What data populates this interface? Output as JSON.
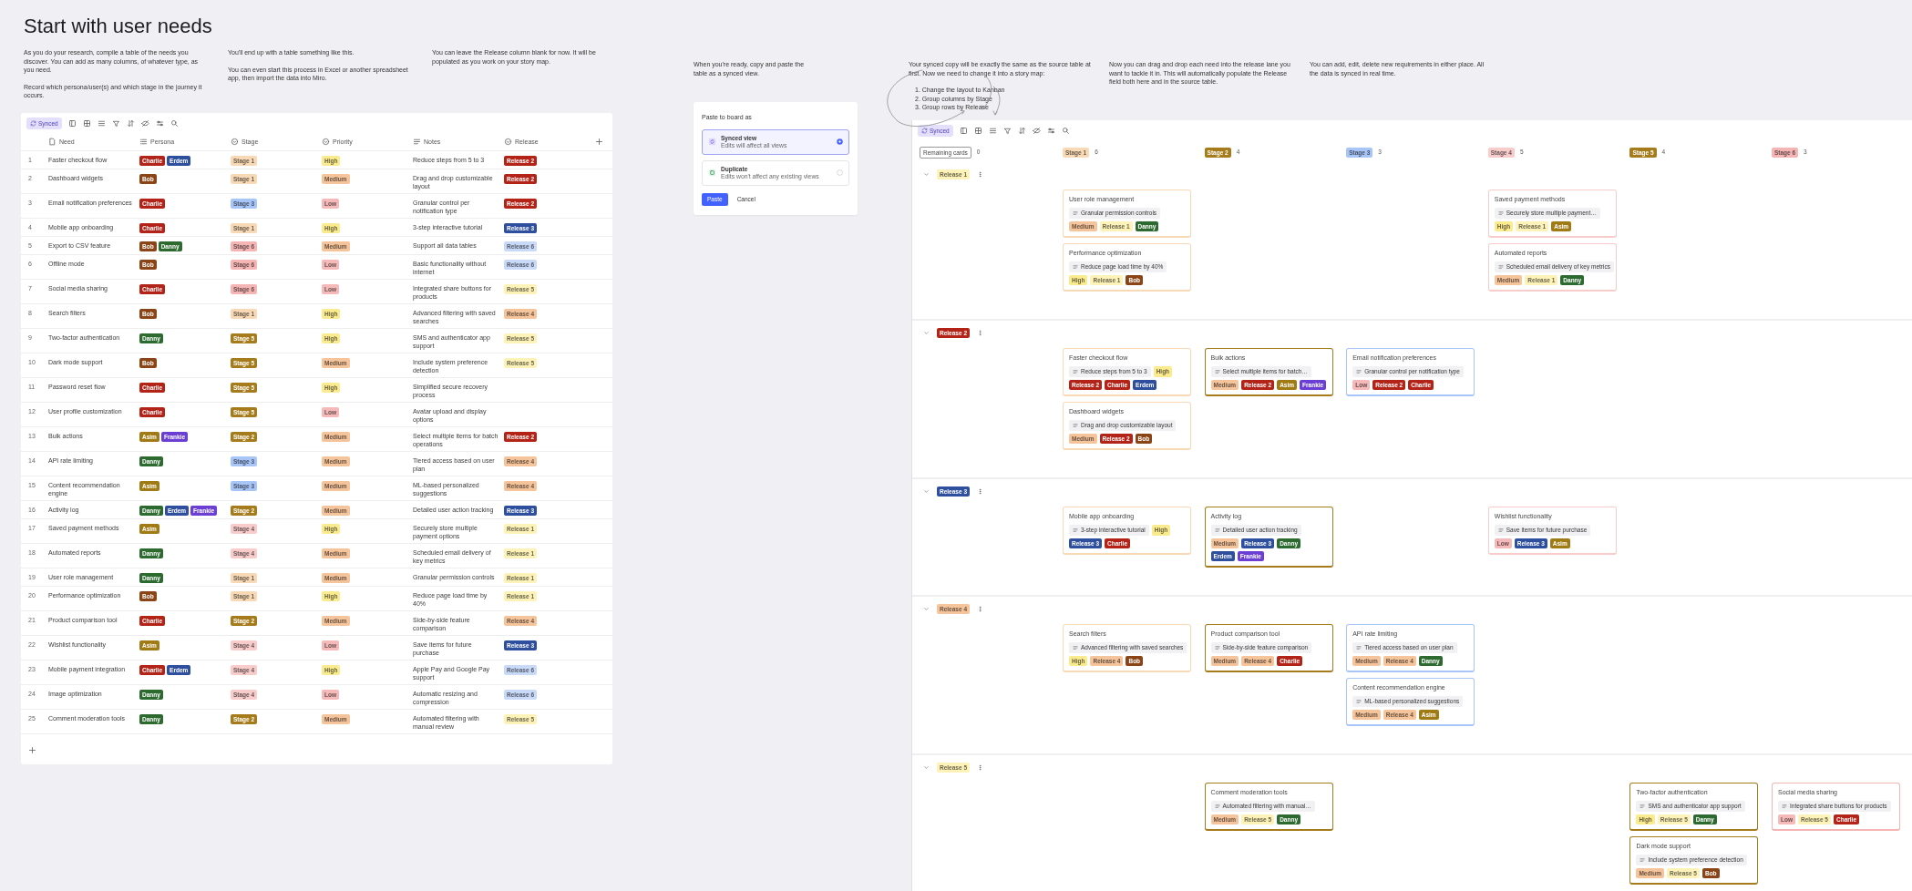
{
  "page": {
    "title": "Start with user needs"
  },
  "left_notes": [
    {
      "paragraphs": [
        "As you do your research, compile a table of the needs you discover. You can add as many columns, of whatever type, as you need.",
        "Record which persona/user(s) and which stage in the journey it occurs."
      ]
    },
    {
      "paragraphs": [
        "You'll end up with a table something like this.",
        "You can even start this process in Excel or another spreadsheet app, then import the data into Miro."
      ]
    },
    {
      "paragraphs": [
        "You can leave the Release column blank for now. It will be populated as you work on your story map."
      ]
    }
  ],
  "table": {
    "toolbar": {
      "label": "Synced"
    },
    "columns": [
      {
        "label": "Need",
        "kind": "title"
      },
      {
        "label": "Persona",
        "kind": "multi"
      },
      {
        "label": "Stage",
        "kind": "single"
      },
      {
        "label": "Priority",
        "kind": "single"
      },
      {
        "label": "Notes",
        "kind": "text"
      },
      {
        "label": "Release",
        "kind": "single"
      }
    ],
    "rows": [
      {
        "number": "1",
        "need": "Faster checkout flow",
        "persona": [
          {
            "text": "Charlie",
            "color": "#b42318"
          },
          {
            "text": "Erdem",
            "color": "#2e4f9e"
          }
        ],
        "stage": {
          "text": "Stage 1",
          "color": "#f8d9b6"
        },
        "priority": {
          "text": "High",
          "color": "#fbeb8f"
        },
        "notes": "Reduce steps from 5 to 3",
        "release": {
          "text": "Release 2",
          "color": "#b42318"
        }
      },
      {
        "number": "2",
        "need": "Dashboard widgets",
        "persona": [
          {
            "text": "Bob",
            "color": "#8a4416"
          }
        ],
        "stage": {
          "text": "Stage 1",
          "color": "#f8d9b6"
        },
        "priority": {
          "text": "Medium",
          "color": "#f6c49a"
        },
        "notes": "Drag and drop customizable layout",
        "release": {
          "text": "Release 2",
          "color": "#b42318"
        }
      },
      {
        "number": "3",
        "need": "Email notification preferences",
        "persona": [
          {
            "text": "Charlie",
            "color": "#b42318"
          }
        ],
        "stage": {
          "text": "Stage 3",
          "color": "#a8c5f7"
        },
        "priority": {
          "text": "Low",
          "color": "#f6b9b9"
        },
        "notes": "Granular control per notification type",
        "release": {
          "text": "Release 2",
          "color": "#b42318"
        }
      },
      {
        "number": "4",
        "need": "Mobile app onboarding",
        "persona": [
          {
            "text": "Charlie",
            "color": "#b42318"
          }
        ],
        "stage": {
          "text": "Stage 1",
          "color": "#f8d9b6"
        },
        "priority": {
          "text": "High",
          "color": "#fbeb8f"
        },
        "notes": "3-step interactive tutorial",
        "release": {
          "text": "Release 3",
          "color": "#2e4f9e"
        }
      },
      {
        "number": "5",
        "need": "Export to CSV feature",
        "persona": [
          {
            "text": "Bob",
            "color": "#8a4416"
          },
          {
            "text": "Danny",
            "color": "#2d6a2f"
          }
        ],
        "stage": {
          "text": "Stage 6",
          "color": "#f5b5b5"
        },
        "priority": {
          "text": "Medium",
          "color": "#f6c49a"
        },
        "notes": "Support all data tables",
        "release": {
          "text": "Release 6",
          "color": "#c9d9f8"
        }
      },
      {
        "number": "6",
        "need": "Offline mode",
        "persona": [
          {
            "text": "Bob",
            "color": "#8a4416"
          }
        ],
        "stage": {
          "text": "Stage 6",
          "color": "#f5b5b5"
        },
        "priority": {
          "text": "Low",
          "color": "#f6b9b9"
        },
        "notes": "Basic functionality without internet",
        "release": {
          "text": "Release 6",
          "color": "#c9d9f8"
        }
      },
      {
        "number": "7",
        "need": "Social media sharing",
        "persona": [
          {
            "text": "Charlie",
            "color": "#b42318"
          }
        ],
        "stage": {
          "text": "Stage 6",
          "color": "#f5b5b5"
        },
        "priority": {
          "text": "Low",
          "color": "#f6b9b9"
        },
        "notes": "Integrated share buttons for products",
        "release": {
          "text": "Release 5",
          "color": "#fdf2b8"
        }
      },
      {
        "number": "8",
        "need": "Search filters",
        "persona": [
          {
            "text": "Bob",
            "color": "#8a4416"
          }
        ],
        "stage": {
          "text": "Stage 1",
          "color": "#f8d9b6"
        },
        "priority": {
          "text": "High",
          "color": "#fbeb8f"
        },
        "notes": "Advanced filtering with saved searches",
        "release": {
          "text": "Release 4",
          "color": "#f6c49a"
        }
      },
      {
        "number": "9",
        "need": "Two-factor authentication",
        "persona": [
          {
            "text": "Danny",
            "color": "#2d6a2f"
          }
        ],
        "stage": {
          "text": "Stage 5",
          "color": "#a57b1c"
        },
        "priority": {
          "text": "High",
          "color": "#fbeb8f"
        },
        "notes": "SMS and authenticator app support",
        "release": {
          "text": "Release 5",
          "color": "#fdf2b8"
        }
      },
      {
        "number": "10",
        "need": "Dark mode support",
        "persona": [
          {
            "text": "Bob",
            "color": "#8a4416"
          }
        ],
        "stage": {
          "text": "Stage 5",
          "color": "#a57b1c"
        },
        "priority": {
          "text": "Medium",
          "color": "#f6c49a"
        },
        "notes": "Include system preference detection",
        "release": {
          "text": "Release 5",
          "color": "#fdf2b8"
        }
      },
      {
        "number": "11",
        "need": "Password reset flow",
        "persona": [
          {
            "text": "Charlie",
            "color": "#b42318"
          }
        ],
        "stage": {
          "text": "Stage 5",
          "color": "#a57b1c"
        },
        "priority": {
          "text": "High",
          "color": "#fbeb8f"
        },
        "notes": "Simplified secure recovery process"
      },
      {
        "number": "12",
        "need": "User profile customization",
        "persona": [
          {
            "text": "Charlie",
            "color": "#b42318"
          }
        ],
        "stage": {
          "text": "Stage 5",
          "color": "#a57b1c"
        },
        "priority": {
          "text": "Low",
          "color": "#f6b9b9"
        },
        "notes": "Avatar upload and display options"
      },
      {
        "number": "13",
        "need": "Bulk actions",
        "persona": [
          {
            "text": "Asim",
            "color": "#a07b14"
          },
          {
            "text": "Frankie",
            "color": "#6b3fd4"
          }
        ],
        "stage": {
          "text": "Stage 2",
          "color": "#a57b1c"
        },
        "priority": {
          "text": "Medium",
          "color": "#f6c49a"
        },
        "notes": "Select multiple items for batch operations",
        "release": {
          "text": "Release 2",
          "color": "#b42318"
        }
      },
      {
        "number": "14",
        "need": "API rate limiting",
        "persona": [
          {
            "text": "Danny",
            "color": "#2d6a2f"
          }
        ],
        "stage": {
          "text": "Stage 3",
          "color": "#a8c5f7"
        },
        "priority": {
          "text": "Medium",
          "color": "#f6c49a"
        },
        "notes": "Tiered access based on user plan",
        "release": {
          "text": "Release 4",
          "color": "#f6c49a"
        }
      },
      {
        "number": "15",
        "need": "Content recommendation engine",
        "persona": [
          {
            "text": "Asim",
            "color": "#a07b14"
          }
        ],
        "stage": {
          "text": "Stage 3",
          "color": "#a8c5f7"
        },
        "priority": {
          "text": "Medium",
          "color": "#f6c49a"
        },
        "notes": "ML-based personalized suggestions",
        "release": {
          "text": "Release 4",
          "color": "#f6c49a"
        }
      },
      {
        "number": "16",
        "need": "Activity log",
        "persona": [
          {
            "text": "Danny",
            "color": "#2d6a2f"
          },
          {
            "text": "Erdem",
            "color": "#2e4f9e"
          },
          {
            "text": "Frankie",
            "color": "#6b3fd4"
          }
        ],
        "stage": {
          "text": "Stage 2",
          "color": "#a57b1c"
        },
        "priority": {
          "text": "Medium",
          "color": "#f6c49a"
        },
        "notes": "Detailed user action tracking",
        "release": {
          "text": "Release 3",
          "color": "#2e4f9e"
        }
      },
      {
        "number": "17",
        "need": "Saved payment methods",
        "persona": [
          {
            "text": "Asim",
            "color": "#a07b14"
          }
        ],
        "stage": {
          "text": "Stage 4",
          "color": "#f9cccc"
        },
        "priority": {
          "text": "High",
          "color": "#fbeb8f"
        },
        "notes": "Securely store multiple payment options",
        "release": {
          "text": "Release 1",
          "color": "#fdf2b8"
        }
      },
      {
        "number": "18",
        "need": "Automated reports",
        "persona": [
          {
            "text": "Danny",
            "color": "#2d6a2f"
          }
        ],
        "stage": {
          "text": "Stage 4",
          "color": "#f9cccc"
        },
        "priority": {
          "text": "Medium",
          "color": "#f6c49a"
        },
        "notes": "Scheduled email delivery of key metrics",
        "release": {
          "text": "Release 1",
          "color": "#fdf2b8"
        }
      },
      {
        "number": "19",
        "need": "User role management",
        "persona": [
          {
            "text": "Danny",
            "color": "#2d6a2f"
          }
        ],
        "stage": {
          "text": "Stage 1",
          "color": "#f8d9b6"
        },
        "priority": {
          "text": "Medium",
          "color": "#f6c49a"
        },
        "notes": "Granular permission controls",
        "release": {
          "text": "Release 1",
          "color": "#fdf2b8"
        }
      },
      {
        "number": "20",
        "need": "Performance optimization",
        "persona": [
          {
            "text": "Bob",
            "color": "#8a4416"
          }
        ],
        "stage": {
          "text": "Stage 1",
          "color": "#f8d9b6"
        },
        "priority": {
          "text": "High",
          "color": "#fbeb8f"
        },
        "notes": "Reduce page load time by 40%",
        "release": {
          "text": "Release 1",
          "color": "#fdf2b8"
        }
      },
      {
        "number": "21",
        "need": "Product comparison tool",
        "persona": [
          {
            "text": "Charlie",
            "color": "#b42318"
          }
        ],
        "stage": {
          "text": "Stage 2",
          "color": "#a57b1c"
        },
        "priority": {
          "text": "Medium",
          "color": "#f6c49a"
        },
        "notes": "Side-by-side feature comparison",
        "release": {
          "text": "Release 4",
          "color": "#f6c49a"
        }
      },
      {
        "number": "22",
        "need": "Wishlist functionality",
        "persona": [
          {
            "text": "Asim",
            "color": "#a07b14"
          }
        ],
        "stage": {
          "text": "Stage 4",
          "color": "#f9cccc"
        },
        "priority": {
          "text": "Low",
          "color": "#f6b9b9"
        },
        "notes": "Save items for future purchase",
        "release": {
          "text": "Release 3",
          "color": "#2e4f9e"
        }
      },
      {
        "number": "23",
        "need": "Mobile payment integration",
        "persona": [
          {
            "text": "Charlie",
            "color": "#b42318"
          },
          {
            "text": "Erdem",
            "color": "#2e4f9e"
          }
        ],
        "stage": {
          "text": "Stage 4",
          "color": "#f9cccc"
        },
        "priority": {
          "text": "High",
          "color": "#fbeb8f"
        },
        "notes": "Apple Pay and Google Pay support",
        "release": {
          "text": "Release 6",
          "color": "#c9d9f8"
        }
      },
      {
        "number": "24",
        "need": "Image optimization",
        "persona": [
          {
            "text": "Danny",
            "color": "#2d6a2f"
          }
        ],
        "stage": {
          "text": "Stage 4",
          "color": "#f9cccc"
        },
        "priority": {
          "text": "Low",
          "color": "#f6b9b9"
        },
        "notes": "Automatic resizing and compression",
        "release": {
          "text": "Release 6",
          "color": "#c9d9f8"
        }
      },
      {
        "number": "25",
        "need": "Comment moderation tools",
        "persona": [
          {
            "text": "Danny",
            "color": "#2d6a2f"
          }
        ],
        "stage": {
          "text": "Stage 2",
          "color": "#a57b1c"
        },
        "priority": {
          "text": "Medium",
          "color": "#f6c49a"
        },
        "notes": "Automated filtering with manual review",
        "release": {
          "text": "Release 5",
          "color": "#fdf2b8"
        }
      }
    ]
  },
  "middle_note": {
    "paragraphs": [
      "When you're ready, copy and paste the table as a synced view."
    ]
  },
  "dialog": {
    "title": "Paste to board as",
    "options": [
      {
        "label": "Synced view",
        "hint": "Edits will affect all views",
        "kind": "synced",
        "selected": true
      },
      {
        "label": "Duplicate",
        "hint": "Edits won't affect any existing views",
        "kind": "duplicate",
        "selected": false
      }
    ],
    "buttons": [
      {
        "label": "Paste",
        "kind": "primary"
      },
      {
        "label": "Cancel",
        "kind": "plain"
      }
    ]
  },
  "right_notes": [
    {
      "paragraphs": [
        "Your synced copy will be exactly the same as the source table at first. Now we need to change it into a story map:"
      ],
      "steps": [
        "1. Change the layout to Kanban",
        "2. Group columns by Stage",
        "3. Group rows by Release"
      ]
    },
    {
      "paragraphs": [
        "Now you can drag and drop each need into the release lane you want to tackle it in. This will automatically populate the Release field both here and in the source table."
      ]
    },
    {
      "paragraphs": [
        "You can add, edit, delete new requirements in either place. All the data is synced in real time."
      ]
    }
  ],
  "board": {
    "toolbar": {
      "label": "Synced"
    },
    "columns": [
      {
        "label": "Remaining cards",
        "count": "0",
        "kind": "outline"
      },
      {
        "label": "Stage 1",
        "count": "6",
        "kind": "tag",
        "color": "#f8d9b6"
      },
      {
        "label": "Stage 2",
        "count": "4",
        "kind": "tag",
        "color": "#a57b1c"
      },
      {
        "label": "Stage 3",
        "count": "3",
        "kind": "tag",
        "color": "#a8c5f7"
      },
      {
        "label": "Stage 4",
        "count": "5",
        "kind": "tag",
        "color": "#f9cccc"
      },
      {
        "label": "Stage 5",
        "count": "4",
        "kind": "tag",
        "color": "#a57b1c"
      },
      {
        "label": "Stage 6",
        "count": "3",
        "kind": "tag",
        "color": "#f5b5b5"
      }
    ],
    "lanes": [
      {
        "release": {
          "text": "Release 1",
          "color": "#fdf2b8"
        },
        "expanded": true,
        "stage_1": [
          {
            "title": "User role management",
            "note": "Granular permission controls",
            "tags": [
              {
                "text": "Medium",
                "color": "#f6c49a"
              },
              {
                "text": "Release 1",
                "color": "#fdf2b8"
              },
              {
                "text": "Danny",
                "color": "#2d6a2f"
              }
            ]
          },
          {
            "title": "Performance optimization",
            "note": "Reduce page load time by 40%",
            "tags": [
              {
                "text": "High",
                "color": "#fbeb8f"
              },
              {
                "text": "Release 1",
                "color": "#fdf2b8"
              },
              {
                "text": "Bob",
                "color": "#8a4416"
              }
            ]
          }
        ],
        "stage_4": [
          {
            "title": "Saved payment methods",
            "note": "Securely store multiple payment…",
            "tags": [
              {
                "text": "High",
                "color": "#fbeb8f"
              },
              {
                "text": "Release 1",
                "color": "#fdf2b8"
              },
              {
                "text": "Asim",
                "color": "#a07b14"
              }
            ]
          },
          {
            "title": "Automated reports",
            "note": "Scheduled email delivery of key metrics",
            "tags": [
              {
                "text": "Medium",
                "color": "#f6c49a"
              },
              {
                "text": "Release 1",
                "color": "#fdf2b8"
              },
              {
                "text": "Danny",
                "color": "#2d6a2f"
              }
            ]
          }
        ]
      },
      {
        "release": {
          "text": "Release 2",
          "color": "#b42318"
        },
        "expanded": true,
        "stage_1": [
          {
            "title": "Faster checkout flow",
            "note": "Reduce steps from 5 to 3",
            "tags": [
              {
                "text": "High",
                "color": "#fbeb8f"
              },
              {
                "text": "Release 2",
                "color": "#b42318"
              },
              {
                "text": "Charlie",
                "color": "#b42318"
              },
              {
                "text": "Erdem",
                "color": "#2e4f9e"
              }
            ]
          },
          {
            "title": "Dashboard widgets",
            "note": "Drag and drop customizable layout",
            "tags": [
              {
                "text": "Medium",
                "color": "#f6c49a"
              },
              {
                "text": "Release 2",
                "color": "#b42318"
              },
              {
                "text": "Bob",
                "color": "#8a4416"
              }
            ]
          }
        ],
        "stage_2": [
          {
            "title": "Bulk actions",
            "note": "Select multiple items for batch…",
            "tags": [
              {
                "text": "Medium",
                "color": "#f6c49a"
              },
              {
                "text": "Release 2",
                "color": "#b42318"
              },
              {
                "text": "Asim",
                "color": "#a07b14"
              },
              {
                "text": "Frankie",
                "color": "#6b3fd4"
              }
            ]
          }
        ],
        "stage_3": [
          {
            "title": "Email notification preferences",
            "note": "Granular control per notification type",
            "tags": [
              {
                "text": "Low",
                "color": "#f6b9b9"
              },
              {
                "text": "Release 2",
                "color": "#b42318"
              },
              {
                "text": "Charlie",
                "color": "#b42318"
              }
            ]
          }
        ]
      },
      {
        "release": {
          "text": "Release 3",
          "color": "#2e4f9e"
        },
        "expanded": true,
        "stage_1": [
          {
            "title": "Mobile app onboarding",
            "note": "3-step interactive tutorial",
            "tags": [
              {
                "text": "High",
                "color": "#fbeb8f"
              },
              {
                "text": "Release 3",
                "color": "#2e4f9e"
              },
              {
                "text": "Charlie",
                "color": "#b42318"
              }
            ]
          }
        ],
        "stage_2": [
          {
            "title": "Activity log",
            "note": "Detailed user action tracking",
            "tags": [
              {
                "text": "Medium",
                "color": "#f6c49a"
              },
              {
                "text": "Release 3",
                "color": "#2e4f9e"
              },
              {
                "text": "Danny",
                "color": "#2d6a2f"
              },
              {
                "text": "Erdem",
                "color": "#2e4f9e"
              },
              {
                "text": "Frankie",
                "color": "#6b3fd4"
              }
            ]
          }
        ],
        "stage_4": [
          {
            "title": "Wishlist functionality",
            "note": "Save items for future purchase",
            "tags": [
              {
                "text": "Low",
                "color": "#f6b9b9"
              },
              {
                "text": "Release 3",
                "color": "#2e4f9e"
              },
              {
                "text": "Asim",
                "color": "#a07b14"
              }
            ]
          }
        ]
      },
      {
        "release": {
          "text": "Release 4",
          "color": "#f6c49a"
        },
        "expanded": true,
        "stage_1": [
          {
            "title": "Search filters",
            "note": "Advanced filtering with saved searches",
            "tags": [
              {
                "text": "High",
                "color": "#fbeb8f"
              },
              {
                "text": "Release 4",
                "color": "#f6c49a"
              },
              {
                "text": "Bob",
                "color": "#8a4416"
              }
            ]
          }
        ],
        "stage_2": [
          {
            "title": "Product comparison tool",
            "note": "Side-by-side feature comparison",
            "tags": [
              {
                "text": "Medium",
                "color": "#f6c49a"
              },
              {
                "text": "Release 4",
                "color": "#f6c49a"
              },
              {
                "text": "Charlie",
                "color": "#b42318"
              }
            ]
          }
        ],
        "stage_3": [
          {
            "title": "API rate limiting",
            "note": "Tiered access based on user plan",
            "tags": [
              {
                "text": "Medium",
                "color": "#f6c49a"
              },
              {
                "text": "Release 4",
                "color": "#f6c49a"
              },
              {
                "text": "Danny",
                "color": "#2d6a2f"
              }
            ]
          },
          {
            "title": "Content recommendation engine",
            "note": "ML-based personalized suggestions",
            "tags": [
              {
                "text": "Medium",
                "color": "#f6c49a"
              },
              {
                "text": "Release 4",
                "color": "#f6c49a"
              },
              {
                "text": "Asim",
                "color": "#a07b14"
              }
            ]
          }
        ]
      },
      {
        "release": {
          "text": "Release 5",
          "color": "#fdf2b8"
        },
        "expanded": true,
        "stage_2": [
          {
            "title": "Comment moderation tools",
            "note": "Automated filtering with manual…",
            "tags": [
              {
                "text": "Medium",
                "color": "#f6c49a"
              },
              {
                "text": "Release 5",
                "color": "#fdf2b8"
              },
              {
                "text": "Danny",
                "color": "#2d6a2f"
              }
            ]
          }
        ],
        "stage_5": [
          {
            "title": "Two-factor authentication",
            "note": "SMS and authenticator app support",
            "tags": [
              {
                "text": "High",
                "color": "#fbeb8f"
              },
              {
                "text": "Release 5",
                "color": "#fdf2b8"
              },
              {
                "text": "Danny",
                "color": "#2d6a2f"
              }
            ]
          },
          {
            "title": "Dark mode support",
            "note": "Include system preference detection",
            "tags": [
              {
                "text": "Medium",
                "color": "#f6c49a"
              },
              {
                "text": "Release 5",
                "color": "#fdf2b8"
              },
              {
                "text": "Bob",
                "color": "#8a4416"
              }
            ]
          }
        ],
        "stage_6": [
          {
            "title": "Social media sharing",
            "note": "Integrated share buttons for products",
            "tags": [
              {
                "text": "Low",
                "color": "#f6b9b9"
              },
              {
                "text": "Release 5",
                "color": "#fdf2b8"
              },
              {
                "text": "Charlie",
                "color": "#b42318"
              }
            ]
          }
        ]
      }
    ]
  }
}
